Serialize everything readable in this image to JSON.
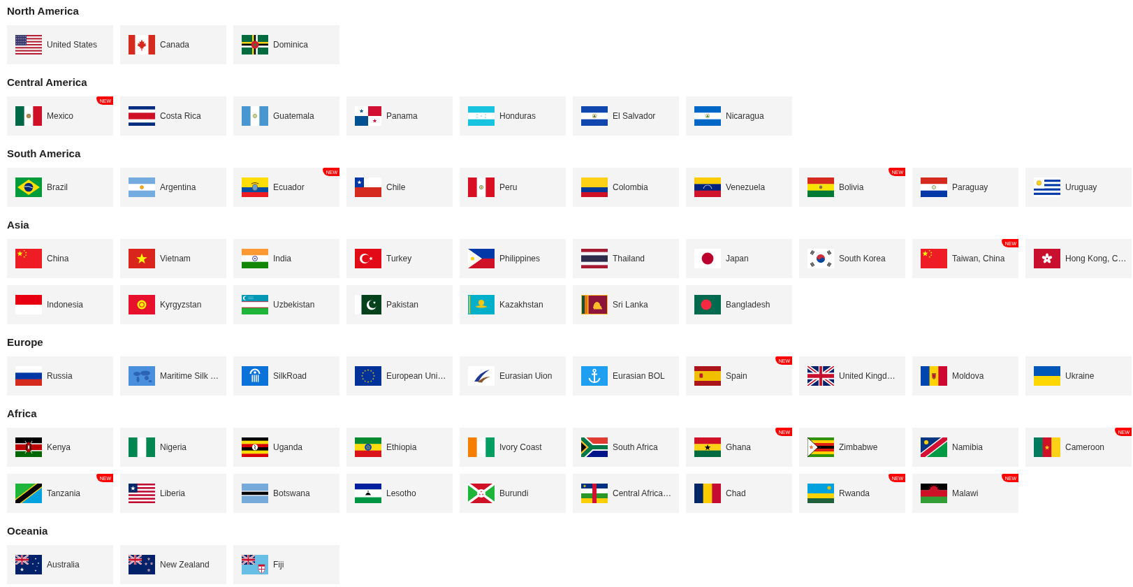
{
  "regions": [
    {
      "title": "North America",
      "countries": [
        {
          "name": "United States"
        },
        {
          "name": "Canada"
        },
        {
          "name": "Dominica"
        }
      ]
    },
    {
      "title": "Central America",
      "countries": [
        {
          "name": "Mexico",
          "badge": "NEW"
        },
        {
          "name": "Costa Rica"
        },
        {
          "name": "Guatemala"
        },
        {
          "name": "Panama"
        },
        {
          "name": "Honduras"
        },
        {
          "name": "El Salvador"
        },
        {
          "name": "Nicaragua"
        }
      ]
    },
    {
      "title": "South America",
      "countries": [
        {
          "name": "Brazil"
        },
        {
          "name": "Argentina"
        },
        {
          "name": "Ecuador",
          "badge": "NEW"
        },
        {
          "name": "Chile"
        },
        {
          "name": "Peru"
        },
        {
          "name": "Colombia"
        },
        {
          "name": "Venezuela"
        },
        {
          "name": "Bolivia",
          "badge": "NEW"
        },
        {
          "name": "Paraguay"
        },
        {
          "name": "Uruguay"
        }
      ]
    },
    {
      "title": "Asia",
      "countries": [
        {
          "name": "China"
        },
        {
          "name": "Vietnam"
        },
        {
          "name": "India"
        },
        {
          "name": "Turkey"
        },
        {
          "name": "Philippines"
        },
        {
          "name": "Thailand"
        },
        {
          "name": "Japan"
        },
        {
          "name": "South Korea"
        },
        {
          "name": "Taiwan, China",
          "badge": "NEW"
        },
        {
          "name": "Hong Kong, C…"
        },
        {
          "name": "Indonesia"
        },
        {
          "name": "Kyrgyzstan"
        },
        {
          "name": "Uzbekistan"
        },
        {
          "name": "Pakistan"
        },
        {
          "name": "Kazakhstan"
        },
        {
          "name": "Sri Lanka"
        },
        {
          "name": "Bangladesh"
        }
      ]
    },
    {
      "title": "Europe",
      "countries": [
        {
          "name": "Russia"
        },
        {
          "name": "Maritime Silk …"
        },
        {
          "name": "SilkRoad"
        },
        {
          "name": "European Uni…"
        },
        {
          "name": "Eurasian Uion"
        },
        {
          "name": "Eurasian BOL"
        },
        {
          "name": "Spain",
          "badge": "NEW"
        },
        {
          "name": "United Kingd…"
        },
        {
          "name": "Moldova"
        },
        {
          "name": "Ukraine"
        }
      ]
    },
    {
      "title": "Africa",
      "countries": [
        {
          "name": "Kenya"
        },
        {
          "name": "Nigeria"
        },
        {
          "name": "Uganda"
        },
        {
          "name": "Ethiopia"
        },
        {
          "name": "Ivory Coast"
        },
        {
          "name": "South Africa"
        },
        {
          "name": "Ghana",
          "badge": "NEW"
        },
        {
          "name": "Zimbabwe"
        },
        {
          "name": "Namibia"
        },
        {
          "name": "Cameroon",
          "badge": "NEW"
        },
        {
          "name": "Tanzania",
          "badge": "NEW"
        },
        {
          "name": "Liberia"
        },
        {
          "name": "Botswana"
        },
        {
          "name": "Lesotho"
        },
        {
          "name": "Burundi"
        },
        {
          "name": "Central Africa…"
        },
        {
          "name": "Chad"
        },
        {
          "name": "Rwanda",
          "badge": "NEW"
        },
        {
          "name": "Malawi",
          "badge": "NEW"
        }
      ]
    },
    {
      "title": "Oceania",
      "countries": [
        {
          "name": "Australia"
        },
        {
          "name": "New Zealand"
        },
        {
          "name": "Fiji"
        }
      ]
    }
  ]
}
